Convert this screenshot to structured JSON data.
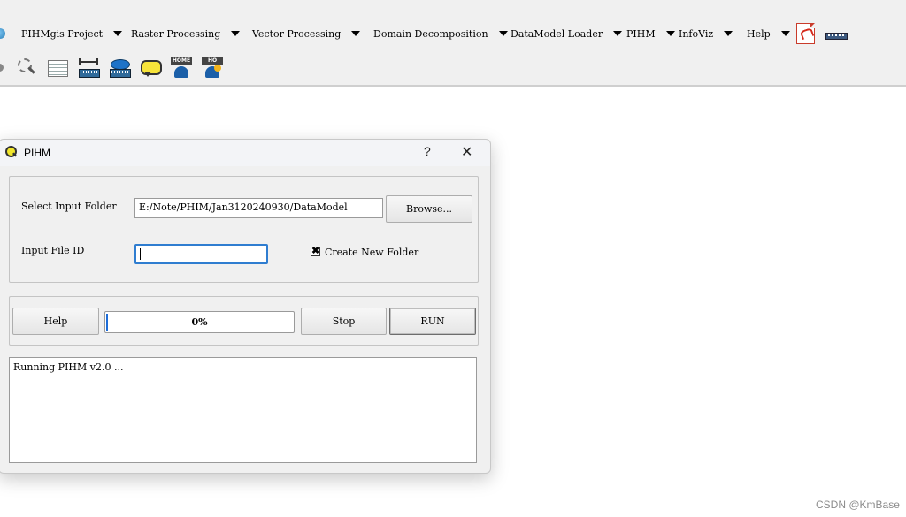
{
  "menubar": {
    "items": [
      {
        "label": "PIHMgis Project"
      },
      {
        "label": "Raster Processing"
      },
      {
        "label": "Vector Processing"
      },
      {
        "label": "Domain Decomposition"
      },
      {
        "label": "DataModel Loader"
      },
      {
        "label": "PIHM"
      },
      {
        "label": "InfoViz"
      },
      {
        "label": "Help"
      }
    ],
    "icons": [
      "globe-icon",
      "pdf-icon",
      "ruler-icon"
    ]
  },
  "toolbar": {
    "icons": [
      "zoom-select-icon",
      "attribute-table-icon",
      "measure-ruler-icon",
      "measure-area-icon",
      "annotation-bubble-icon",
      "home-user-icon",
      "home-user-badge-icon"
    ]
  },
  "dialog": {
    "title": "PIHM",
    "help_symbol": "?",
    "close_symbol": "✕",
    "input_folder": {
      "label": "Select Input Folder",
      "value": "E:/Note/PHIM/Jan3120240930/DataModel",
      "browse_label": "Browse..."
    },
    "file_id": {
      "label": "Input File ID",
      "value": ""
    },
    "create_folder": {
      "label": "Create New Folder",
      "checked": true,
      "check_mark": "✖"
    },
    "actions": {
      "help_label": "Help",
      "stop_label": "Stop",
      "run_label": "RUN"
    },
    "progress": {
      "value": 0,
      "text": "0%"
    },
    "log": "Running PIHM v2.0 ..."
  },
  "watermark": "CSDN @KmBase"
}
